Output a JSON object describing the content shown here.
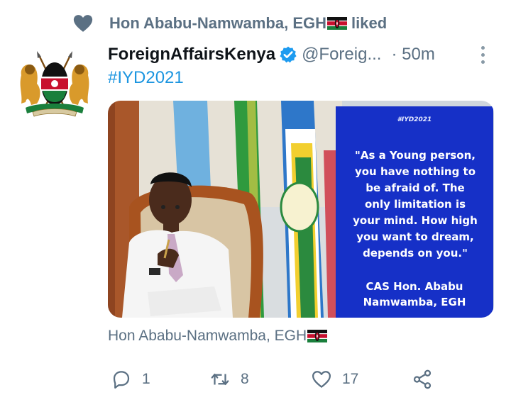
{
  "social_context": {
    "user": "Hon Ababu-Namwamba, EGH",
    "action": "liked"
  },
  "tweet": {
    "author_name": "ForeignAffairsKenya",
    "handle": "@Foreig...",
    "time": "· 50m",
    "hashtag": "#IYD2021"
  },
  "media": {
    "tag": "#IYD2021",
    "quote": "\"As a Young person,\nyou have nothing to\nbe afraid of.  The\nonly limitation is\nyour mind.  How high\nyou want to dream,\ndepends on you.\"",
    "signature": "CAS  Hon. Ababu\nNamwamba, EGH"
  },
  "photo_credit": "Hon Ababu-Namwamba, EGH",
  "actions": {
    "reply_count": "1",
    "retweet_count": "8",
    "like_count": "17"
  },
  "colors": {
    "accent": "#1b95e0",
    "muted": "#5b7083",
    "quote_panel": "#1630c7"
  },
  "icons": [
    "heart-icon",
    "kenya-flag-icon",
    "verified-badge-icon",
    "more-icon",
    "reply-icon",
    "retweet-icon",
    "like-icon",
    "share-icon"
  ]
}
